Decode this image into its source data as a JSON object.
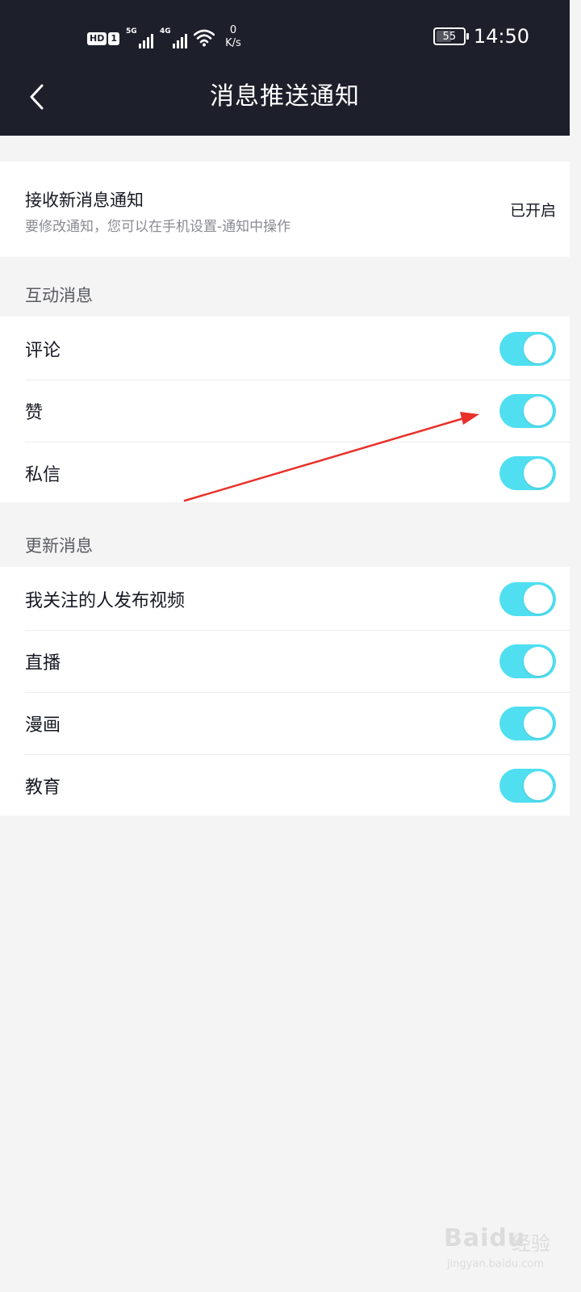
{
  "status_bar": {
    "hd_label": "HD",
    "sim_label": "1",
    "net1_label": "5G",
    "net2_label": "4G",
    "speed_value": "0",
    "speed_unit": "K/s",
    "battery_level": "55",
    "time": "14:50"
  },
  "header": {
    "title": "消息推送通知",
    "back_icon": "chevron-left-icon"
  },
  "master": {
    "title": "接收新消息通知",
    "subtitle": "要修改通知，您可以在手机设置-通知中操作",
    "status": "已开启"
  },
  "sections": [
    {
      "title": "互动消息",
      "items": [
        {
          "label": "评论",
          "on": true
        },
        {
          "label": "赞",
          "on": true
        },
        {
          "label": "私信",
          "on": true
        }
      ]
    },
    {
      "title": "更新消息",
      "items": [
        {
          "label": "我关注的人发布视频",
          "on": true
        },
        {
          "label": "直播",
          "on": true
        },
        {
          "label": "漫画",
          "on": true
        },
        {
          "label": "教育",
          "on": true
        }
      ]
    }
  ],
  "colors": {
    "header_bg": "#1d1f2b",
    "toggle_on": "#4fdff1",
    "annotation_arrow": "#e8312a"
  },
  "watermark": {
    "logo": "Baidu",
    "cn": "经验",
    "url": "jingyan.baidu.com"
  }
}
